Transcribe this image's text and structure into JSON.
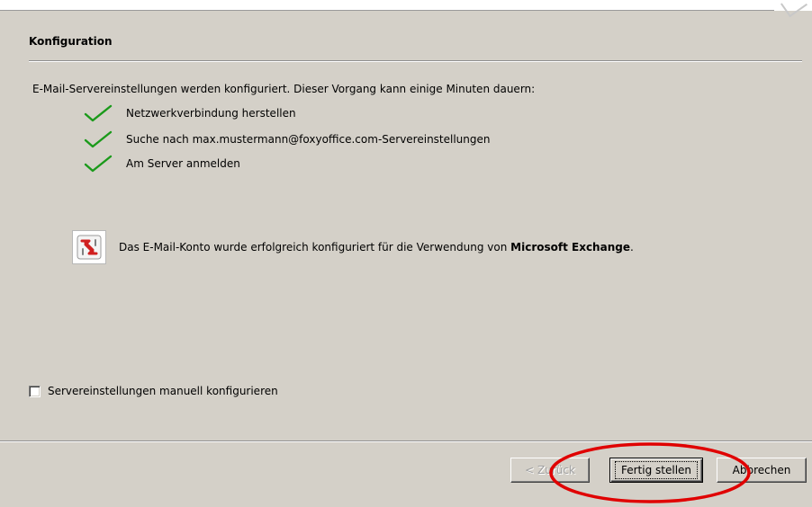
{
  "section": {
    "title": "Konfiguration",
    "intro": "E-Mail-Servereinstellungen werden konfiguriert. Dieser Vorgang kann einige Minuten dauern:"
  },
  "steps": [
    {
      "label": "Netzwerkverbindung herstellen",
      "icon": "checkmark-icon",
      "status": "done"
    },
    {
      "label": "Suche nach max.mustermann@foxyoffice.com-Servereinstellungen",
      "icon": "checkmark-icon",
      "status": "done"
    },
    {
      "label": "Am Server anmelden",
      "icon": "checkmark-icon",
      "status": "done"
    }
  ],
  "result": {
    "icon": "exchange-icon",
    "text_prefix": "Das E-Mail-Konto wurde erfolgreich konfiguriert für die Verwendung von ",
    "text_bold": "Microsoft Exchange",
    "text_suffix": "."
  },
  "manual_config": {
    "label": "Servereinstellungen manuell konfigurieren",
    "checked": false
  },
  "buttons": {
    "back_label": "< Zurück",
    "back_enabled": false,
    "finish_label": "Fertig stellen",
    "cancel_label": "Abbrechen"
  },
  "colors": {
    "dialog_bg": "#d4d0c8",
    "check_green": "#1a9a1a",
    "exchange_red": "#d02020",
    "highlight_red": "#e00000"
  }
}
